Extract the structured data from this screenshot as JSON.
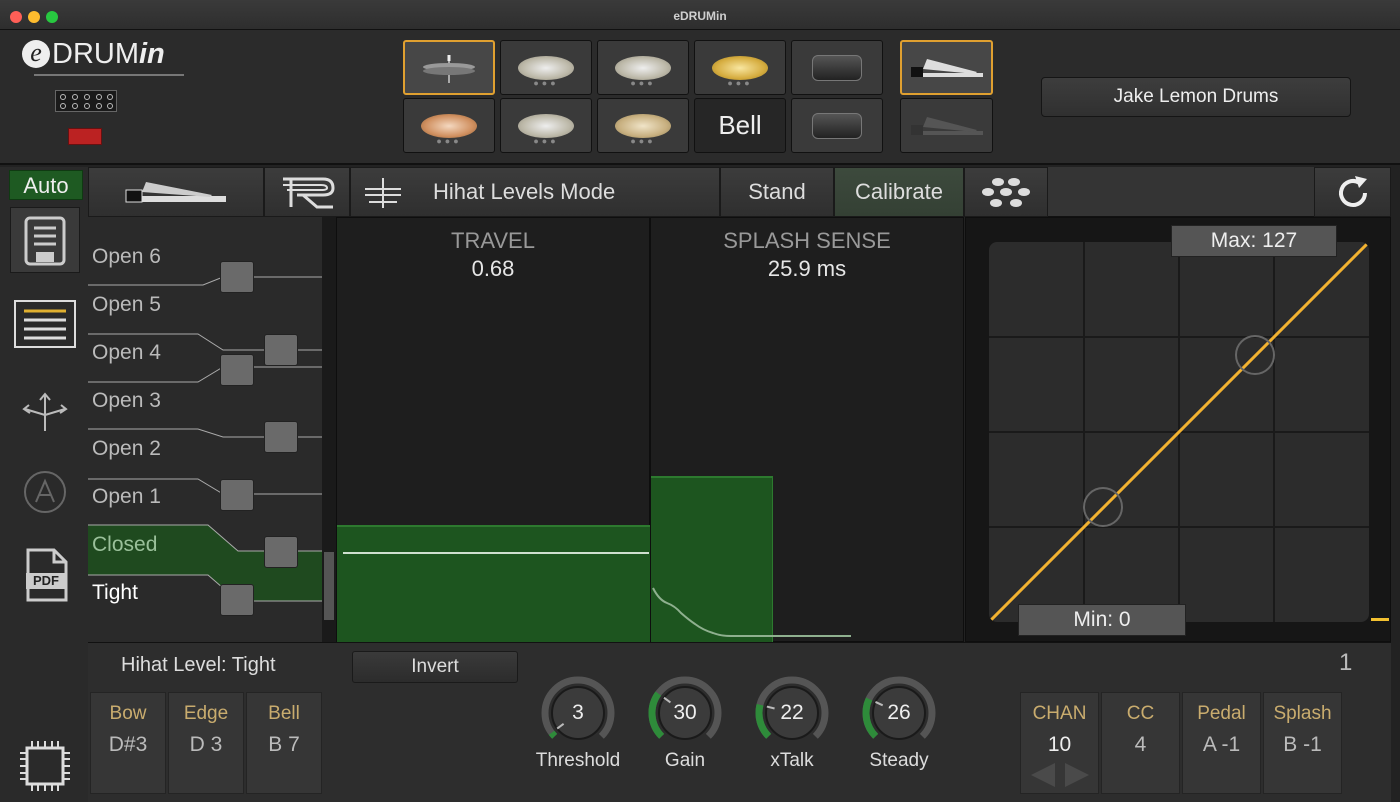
{
  "window": {
    "title": "eDRUMin"
  },
  "logo": {
    "e": "e",
    "drum": "DRUM",
    "in": "in"
  },
  "pads": {
    "row1": [
      {
        "kind": "hihat",
        "selected": true
      },
      {
        "kind": "cymbal"
      },
      {
        "kind": "cymbal"
      },
      {
        "kind": "cymbal-gold"
      },
      {
        "kind": "drum"
      },
      {
        "kind": "pedal",
        "selected": true
      }
    ],
    "row2": [
      {
        "kind": "cymbal-copper"
      },
      {
        "kind": "cymbal"
      },
      {
        "kind": "cymbal-thin"
      },
      {
        "kind": "text",
        "label": "Bell"
      },
      {
        "kind": "drum"
      },
      {
        "kind": "pedal-dim"
      }
    ]
  },
  "kit_name": "Jake Lemon Drums",
  "sidebar": {
    "auto_label": "Auto",
    "icons": [
      "save-icon",
      "list-icon",
      "routing-icon",
      "a-circle-icon",
      "pdf-icon",
      "chip-icon"
    ],
    "pdf_label": "PDF"
  },
  "toolbar": {
    "mode_label": "Hihat Levels Mode",
    "stand_label": "Stand",
    "calibrate_label": "Calibrate"
  },
  "levels": [
    "Open 6",
    "Open 5",
    "Open 4",
    "Open 3",
    "Open 2",
    "Open 1",
    "Closed",
    "Tight"
  ],
  "travel": {
    "title": "TRAVEL",
    "value": "0.68"
  },
  "splash": {
    "title": "SPLASH SENSE",
    "value": "25.9 ms"
  },
  "curve": {
    "max_label": "Max: 127",
    "min_label": "Min: 0"
  },
  "bottom": {
    "hihat_level": "Hihat Level: Tight",
    "invert_label": "Invert",
    "page_number": "1",
    "notes": [
      {
        "label": "Bow",
        "value": "D#3"
      },
      {
        "label": "Edge",
        "value": "D 3"
      },
      {
        "label": "Bell",
        "value": "B 7"
      }
    ],
    "knobs": [
      {
        "label": "Threshold",
        "value": "3",
        "fraction": 0.03,
        "color": "#2e8b3a"
      },
      {
        "label": "Gain",
        "value": "30",
        "fraction": 0.3,
        "color": "#2e8b3a"
      },
      {
        "label": "xTalk",
        "value": "22",
        "fraction": 0.22,
        "color": "#2e8b3a"
      },
      {
        "label": "Steady",
        "value": "26",
        "fraction": 0.26,
        "color": "#2e8b3a"
      }
    ],
    "midi": [
      {
        "label": "CHAN",
        "value": "10"
      },
      {
        "label": "CC",
        "value": "4"
      },
      {
        "label": "Pedal",
        "value": "A -1"
      },
      {
        "label": "Splash",
        "value": "B -1"
      }
    ]
  }
}
